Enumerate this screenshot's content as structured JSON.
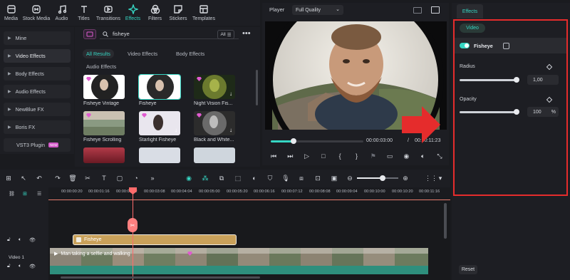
{
  "toolbar": {
    "items": [
      {
        "label": "Media",
        "icon": "media-icon"
      },
      {
        "label": "Stock Media",
        "icon": "stock-media-icon"
      },
      {
        "label": "Audio",
        "icon": "audio-icon"
      },
      {
        "label": "Titles",
        "icon": "titles-icon"
      },
      {
        "label": "Transitions",
        "icon": "transitions-icon"
      },
      {
        "label": "Effects",
        "icon": "effects-icon"
      },
      {
        "label": "Filters",
        "icon": "filters-icon"
      },
      {
        "label": "Stickers",
        "icon": "stickers-icon"
      },
      {
        "label": "Templates",
        "icon": "templates-icon"
      }
    ],
    "active": "Effects"
  },
  "sidebar": {
    "items": [
      {
        "label": "Mine"
      },
      {
        "label": "Video Effects"
      },
      {
        "label": "Body Effects"
      },
      {
        "label": "Audio Effects"
      },
      {
        "label": "NewBlue FX"
      },
      {
        "label": "Boris FX"
      },
      {
        "label": "VST3 Plugin",
        "badge": "NEW"
      }
    ]
  },
  "library": {
    "search_value": "fisheye",
    "filter_label": "All",
    "categories": [
      "All Results",
      "Video Effects",
      "Body Effects",
      "Audio Effects"
    ],
    "effects": [
      {
        "title": "Fisheye Vintage"
      },
      {
        "title": "Fisheye"
      },
      {
        "title": "Night Vision Fis..."
      },
      {
        "title": "Fisheye Scrolling"
      },
      {
        "title": "Starlight Fisheye"
      },
      {
        "title": "Black and White..."
      }
    ]
  },
  "player": {
    "label": "Player",
    "quality": "Full Quality",
    "current_time": "00:00:03:00",
    "separator": "/",
    "total_time": "00:00:11:23",
    "progress": 0.25
  },
  "effects_panel": {
    "tab": "Effects",
    "subtab": "Video",
    "effect_name": "Fisheye",
    "radius_label": "Radius",
    "radius_value": "1,00",
    "opacity_label": "Opacity",
    "opacity_value": "100",
    "opacity_unit": "%",
    "reset_label": "Reset"
  },
  "timeline": {
    "ticks": [
      "00:00:00:20",
      "00:00:01:16",
      "00:00:02:12",
      "00:00:03:08",
      "00:00:04:04",
      "00:00:05:00",
      "00:00:05:20",
      "00:00:06:16",
      "00:00:07:12",
      "00:00:08:08",
      "00:00:09:04",
      "00:00:10:00",
      "00:00:10:20",
      "00:00:11:16"
    ],
    "fx_clip_label": "Fisheye",
    "video_track_label": "Video 1",
    "video_clip_label": "Man taking a selfie and walking"
  },
  "colors": {
    "accent": "#36d6c3",
    "highlight_box": "#e52c2c",
    "fx_clip": "#c9a15a"
  }
}
